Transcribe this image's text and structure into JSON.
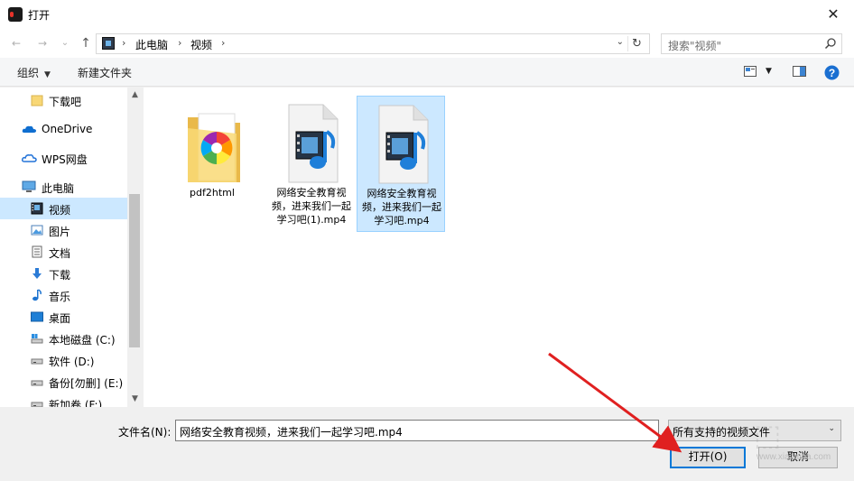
{
  "window": {
    "title": "打开",
    "close_glyph": "✕"
  },
  "nav": {
    "back_glyph": "←",
    "forward_glyph": "→",
    "recent_glyph": "⌄",
    "up_glyph": "↑"
  },
  "address": {
    "sep": "›",
    "crumbs": [
      "此电脑",
      "视频"
    ],
    "dropdown_glyph": "⌄",
    "refresh_glyph": "↻"
  },
  "search": {
    "placeholder": "搜索\"视频\""
  },
  "toolbar": {
    "organize": "组织",
    "organize_caret": "▼",
    "new_folder": "新建文件夹",
    "view_caret": "▼",
    "help_glyph": "?"
  },
  "sidebar": {
    "items": [
      {
        "label": "下载吧",
        "icon": "folder-icon"
      },
      {
        "label": "OneDrive",
        "icon": "cloud-icon"
      },
      {
        "label": "WPS网盘",
        "icon": "wps-cloud-icon"
      },
      {
        "label": "此电脑",
        "icon": "computer-icon"
      },
      {
        "label": "视频",
        "icon": "video-folder-icon",
        "selected": true
      },
      {
        "label": "图片",
        "icon": "pictures-icon"
      },
      {
        "label": "文档",
        "icon": "documents-icon"
      },
      {
        "label": "下载",
        "icon": "download-icon"
      },
      {
        "label": "音乐",
        "icon": "music-icon"
      },
      {
        "label": "桌面",
        "icon": "desktop-icon"
      },
      {
        "label": "本地磁盘 (C:)",
        "icon": "drive-icon"
      },
      {
        "label": "软件 (D:)",
        "icon": "drive-icon"
      },
      {
        "label": "备份[勿删] (E:)",
        "icon": "drive-icon"
      },
      {
        "label": "新加卷 (F:)",
        "icon": "drive-icon"
      }
    ],
    "scroll_up_glyph": "▲",
    "scroll_down_glyph": "▼"
  },
  "files": [
    {
      "name": "pdf2html",
      "icon": "folder-icon",
      "selected": false
    },
    {
      "name": "网络安全教育视频，进来我们一起学习吧(1).mp4",
      "icon": "video-file-icon",
      "selected": false
    },
    {
      "name": "网络安全教育视频，进来我们一起学习吧.mp4",
      "icon": "video-file-icon",
      "selected": true
    }
  ],
  "bottom": {
    "filename_label": "文件名(N):",
    "filename_value": "网络安全教育视频，进来我们一起学习吧.mp4",
    "filter_value": "所有支持的视频文件",
    "filter_caret": "⌄",
    "open_button": "打开(O)",
    "cancel_button": "取消"
  },
  "watermark": {
    "text": "www.xiazaiba.com"
  },
  "colors": {
    "selection": "#cce8ff",
    "selection_border": "#99d1ff",
    "primary_border": "#0078d7",
    "arrow": "#e02020"
  }
}
